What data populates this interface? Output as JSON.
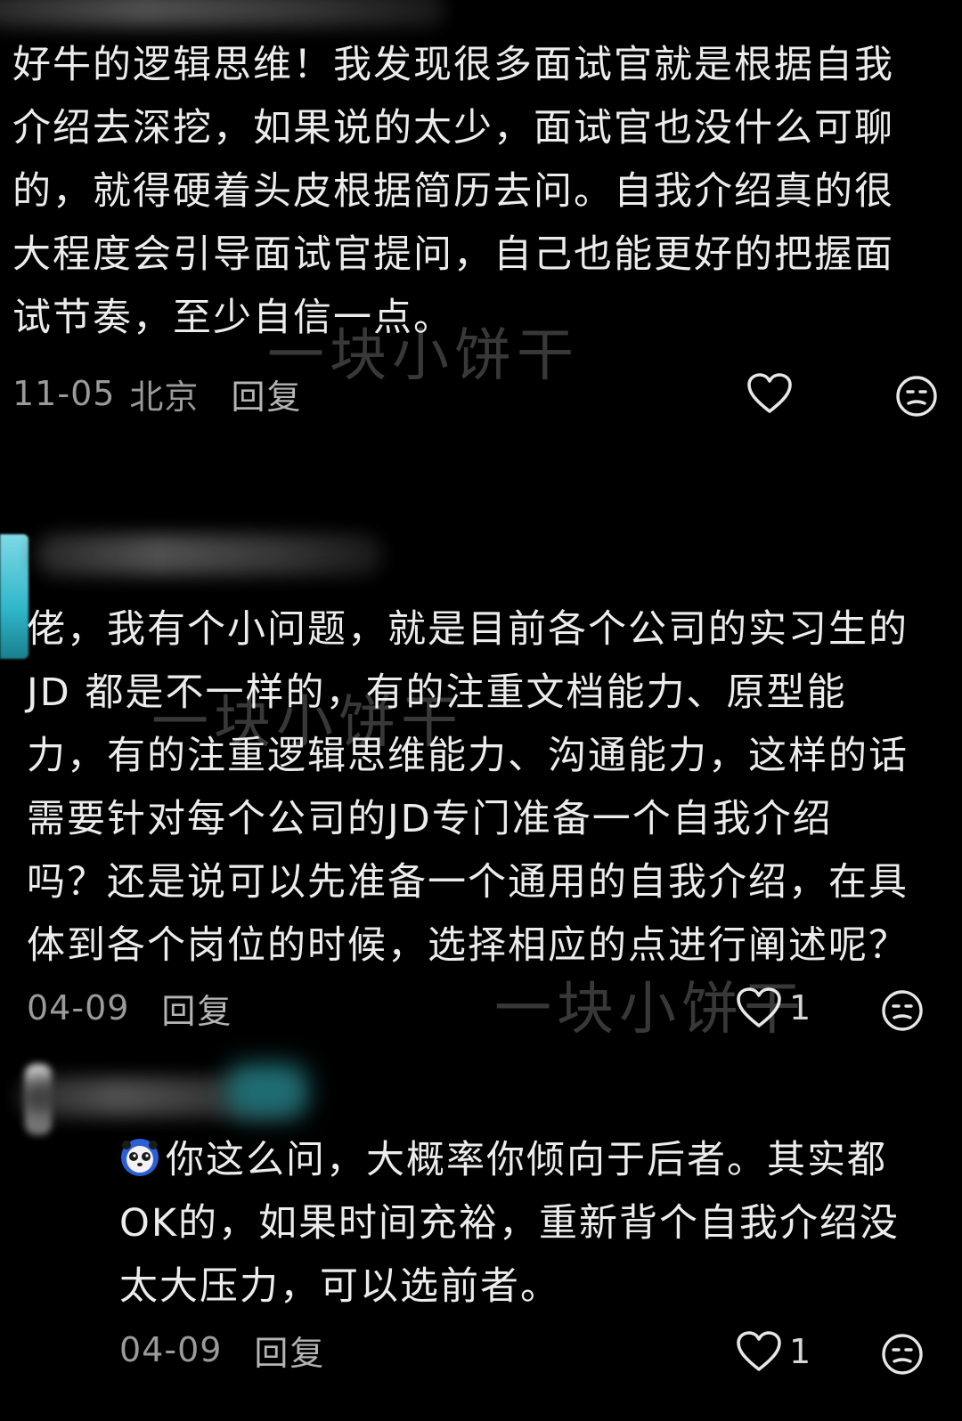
{
  "comments": [
    {
      "text": "好牛的逻辑思维！我发现很多面试官就是根据自我\n介绍去深挖，如果说的太少，面试官也没什么可聊\n的，就得硬着头皮根据简历去问。自我介绍真的很\n大程度会引导面试官提问，自己也能更好的把握面\n试节奏，至少自信一点。",
      "date": "11-05",
      "location": "北京",
      "reply_label": "回复",
      "like_count": ""
    },
    {
      "text": "佬，我有个小问题，就是目前各个公司的实习生的\nJD 都是不一样的，有的注重文档能力、原型能\n力，有的注重逻辑思维能力、沟通能力，这样的话\n需要针对每个公司的JD专门准备一个自我介绍\n吗？还是说可以先准备一个通用的自我介绍，在具\n体到各个岗位的时候，选择相应的点进行阐述呢？",
      "date": "04-09",
      "reply_label": "回复",
      "like_count": "1"
    },
    {
      "text": "你这么问，大概率你倾向于后者。其实都\nOK的，如果时间充裕，重新背个自我介绍没\n太大压力，可以选前者。",
      "emoji_icon": "panda-emoji-icon",
      "date": "04-09",
      "reply_label": "回复",
      "like_count": "1"
    }
  ],
  "watermark": "一块小饼干",
  "icons": {
    "like": "heart-outline-icon",
    "dislike": "unhappy-face-icon"
  },
  "colors": {
    "background": "#000000",
    "text": "#ececec",
    "meta": "#9a9a9a"
  }
}
